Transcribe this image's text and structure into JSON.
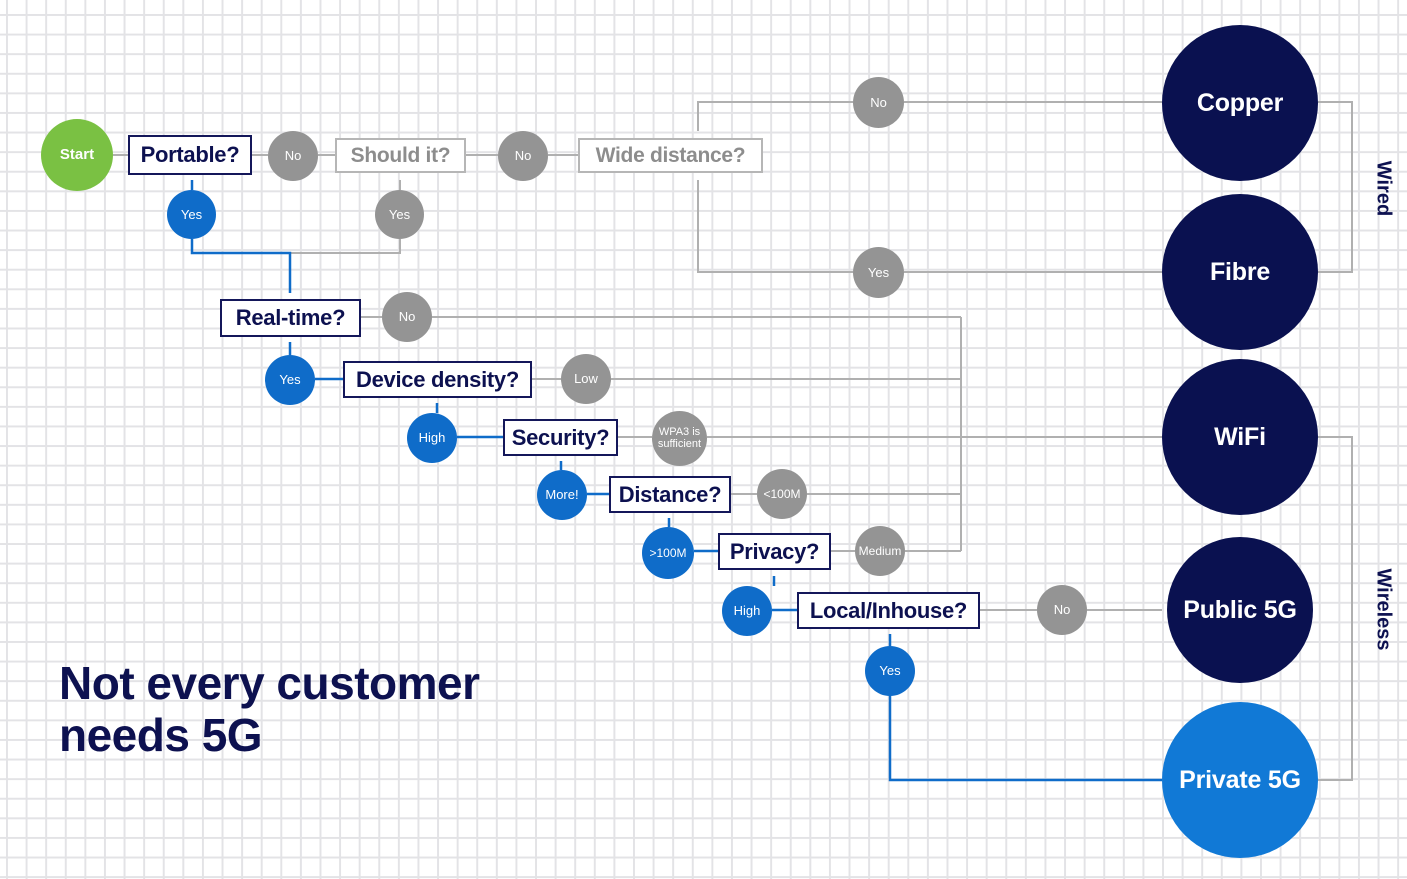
{
  "headline": "Not every customer\nneeds 5G",
  "colors": {
    "navy": "#0a1150",
    "blue": "#0f6cc9",
    "bright_blue": "#1179d6",
    "green": "#7ac143",
    "gray": "#949494",
    "wire_gray": "#b0b0b0",
    "inactive_text": "#8d8d8d"
  },
  "start": {
    "label": "Start"
  },
  "decisions": [
    {
      "id": "portable",
      "label": "Portable?",
      "state": "active"
    },
    {
      "id": "should_it",
      "label": "Should it?",
      "state": "inactive"
    },
    {
      "id": "wide_dist",
      "label": "Wide distance?",
      "state": "inactive"
    },
    {
      "id": "realtime",
      "label": "Real-time?",
      "state": "active"
    },
    {
      "id": "density",
      "label": "Device density?",
      "state": "active"
    },
    {
      "id": "security",
      "label": "Security?",
      "state": "active"
    },
    {
      "id": "distance",
      "label": "Distance?",
      "state": "active"
    },
    {
      "id": "privacy",
      "label": "Privacy?",
      "state": "active"
    },
    {
      "id": "local",
      "label": "Local/Inhouse?",
      "state": "active"
    }
  ],
  "answers": [
    {
      "id": "portable_no",
      "label": "No",
      "state": "inactive"
    },
    {
      "id": "portable_yes",
      "label": "Yes",
      "state": "active"
    },
    {
      "id": "should_no",
      "label": "No",
      "state": "inactive"
    },
    {
      "id": "should_yes",
      "label": "Yes",
      "state": "inactive"
    },
    {
      "id": "wide_no",
      "label": "No",
      "state": "inactive"
    },
    {
      "id": "wide_yes",
      "label": "Yes",
      "state": "inactive"
    },
    {
      "id": "realtime_no",
      "label": "No",
      "state": "inactive"
    },
    {
      "id": "realtime_yes",
      "label": "Yes",
      "state": "active"
    },
    {
      "id": "density_low",
      "label": "Low",
      "state": "inactive"
    },
    {
      "id": "density_high",
      "label": "High",
      "state": "active"
    },
    {
      "id": "security_wpa3",
      "label": "WPA3 is sufficient",
      "state": "inactive"
    },
    {
      "id": "security_more",
      "label": "More!",
      "state": "active"
    },
    {
      "id": "distance_lt",
      "label": "<100M",
      "state": "inactive"
    },
    {
      "id": "distance_gt",
      "label": ">100M",
      "state": "active"
    },
    {
      "id": "privacy_medium",
      "label": "Medium",
      "state": "inactive"
    },
    {
      "id": "privacy_high",
      "label": "High",
      "state": "active"
    },
    {
      "id": "local_no",
      "label": "No",
      "state": "inactive"
    },
    {
      "id": "local_yes",
      "label": "Yes",
      "state": "active"
    }
  ],
  "outcomes": [
    {
      "id": "copper",
      "label": "Copper",
      "group": "Wired",
      "state": "normal"
    },
    {
      "id": "fibre",
      "label": "Fibre",
      "group": "Wired",
      "state": "normal"
    },
    {
      "id": "wifi",
      "label": "WiFi",
      "group": "Wireless",
      "state": "normal"
    },
    {
      "id": "public5g",
      "label": "Public 5G",
      "group": "Wireless",
      "state": "normal"
    },
    {
      "id": "private5g",
      "label": "Private 5G",
      "group": "Wireless",
      "state": "highlighted"
    }
  ],
  "groups": [
    {
      "id": "wired",
      "label": "Wired"
    },
    {
      "id": "wireless",
      "label": "Wireless"
    }
  ]
}
